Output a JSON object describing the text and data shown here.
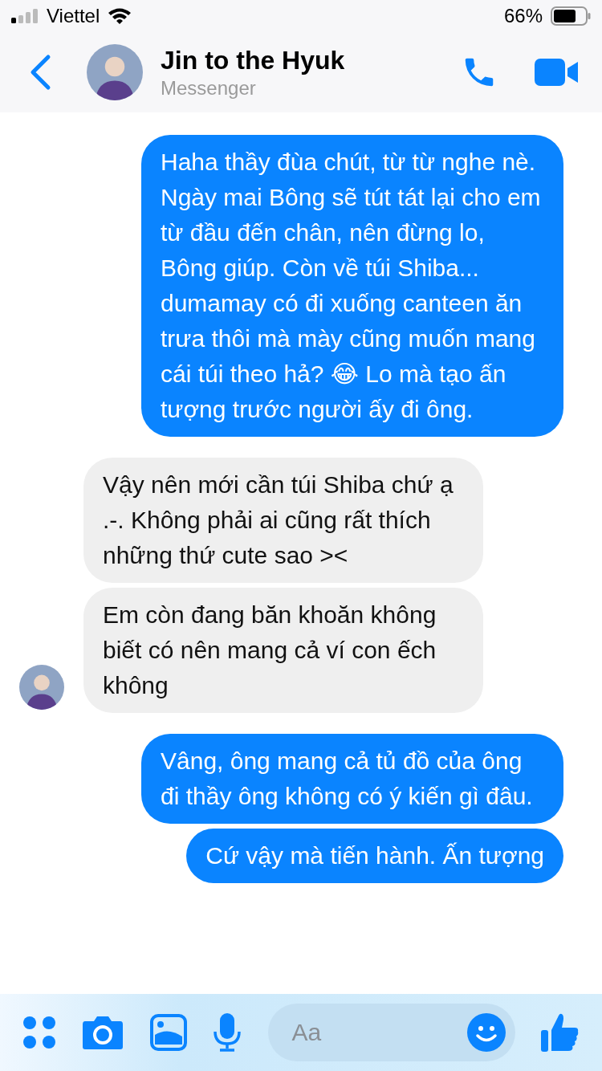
{
  "status_bar": {
    "carrier": "Viettel",
    "battery": "66%"
  },
  "header": {
    "title": "Jin to the Hyuk",
    "subtitle": "Messenger"
  },
  "messages": [
    {
      "kind": "sent",
      "text": "Haha thầy đùa chút, từ từ nghe nè. Ngày mai Bông sẽ tút tát lại cho em từ đầu đến chân, nên đừng lo, Bông giúp. Còn về túi Shiba... dumamay có đi xuống canteen ăn trưa thôi mà mày cũng muốn mang cái túi theo hả? 😂 Lo mà tạo ấn tượng trước người ấy đi ông."
    },
    {
      "kind": "received",
      "text": "Vậy nên mới cần túi Shiba chứ ạ .-. Không phải ai cũng rất thích những thứ cute sao ><",
      "avatar": false
    },
    {
      "kind": "received",
      "text": "Em còn đang băn khoăn không biết có nên mang cả ví con ếch không",
      "avatar": true
    },
    {
      "kind": "sent",
      "text": "Vâng, ông mang cả tủ đồ của ông đi thầy ông không có ý kiến gì đâu."
    },
    {
      "kind": "sent",
      "text": "Cứ vậy mà tiến hành. Ấn tượng"
    }
  ],
  "composer": {
    "placeholder": "Aa"
  }
}
